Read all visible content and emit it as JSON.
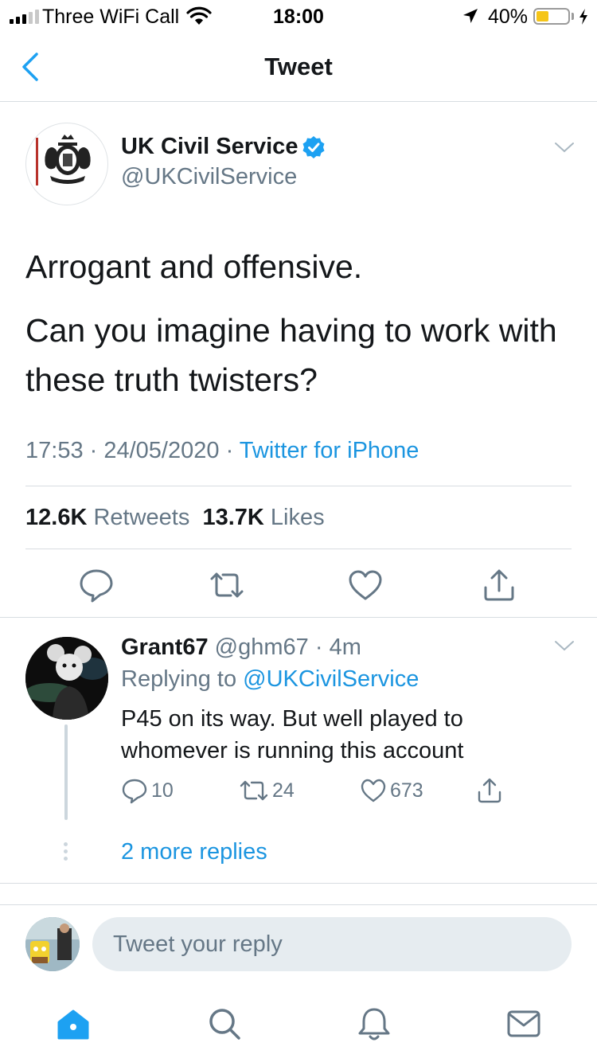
{
  "status_bar": {
    "carrier": "Three WiFi Call",
    "time": "18:00",
    "battery_percent": "40%",
    "battery_level": 0.4,
    "icons": [
      "signal-icon",
      "wifi-icon",
      "location-icon",
      "battery-icon",
      "charging-icon"
    ]
  },
  "nav": {
    "title": "Tweet",
    "back_icon": "chevron-left-icon"
  },
  "tweet": {
    "author_name": "UK Civil Service",
    "author_handle": "@UKCivilService",
    "verified": true,
    "text_line1": "Arrogant and offensive.",
    "text_line2": "Can you imagine having to work with these truth twisters?",
    "time": "17:53",
    "date": "24/05/2020",
    "source": "Twitter for iPhone",
    "retweets_count": "12.6K",
    "retweets_label": "Retweets",
    "likes_count": "13.7K",
    "likes_label": "Likes",
    "sep": " · "
  },
  "reply": {
    "name": "Grant67",
    "handle": "@ghm67",
    "time": "4m",
    "replying_label": "Replying to",
    "replying_to": "@UKCivilService",
    "text": "P45 on its way. But well played to whomever is running this account",
    "reply_count": "10",
    "retweet_count": "24",
    "like_count": "673",
    "more_replies": "2 more replies"
  },
  "compose": {
    "placeholder": "Tweet your reply"
  },
  "tab_bar": {
    "items": [
      "home-icon",
      "search-icon",
      "notifications-icon",
      "messages-icon"
    ],
    "active": "home-icon"
  },
  "colors": {
    "accent": "#1da1f2",
    "link": "#1b95e0",
    "muted": "#657786",
    "text": "#14171a",
    "divider": "#d8dde1",
    "battery": "#f5c518"
  }
}
